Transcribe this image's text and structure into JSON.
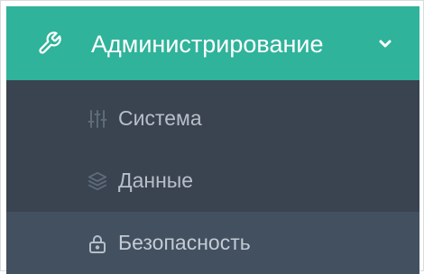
{
  "colors": {
    "header_bg": "#2fb39a",
    "submenu_bg": "#3a4350",
    "active_bg": "#435060",
    "icon_color": "#5e6b79",
    "text_color": "#b6bfc8",
    "header_text": "#ffffff"
  },
  "menu": {
    "title": "Администрирование",
    "icon": "wrench-icon",
    "expanded_icon": "chevron-down-icon",
    "items": [
      {
        "label": "Система",
        "icon": "sliders-icon"
      },
      {
        "label": "Данные",
        "icon": "layers-icon"
      },
      {
        "label": "Безопасность",
        "icon": "lock-icon",
        "active": true
      }
    ]
  }
}
